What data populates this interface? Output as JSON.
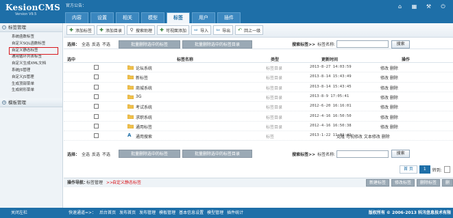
{
  "header": {
    "logo": "KesionCMS",
    "version": "Version V9.5",
    "notice": "官方公告："
  },
  "tabs": [
    {
      "label": "内容",
      "active": false
    },
    {
      "label": "设置",
      "active": false
    },
    {
      "label": "相关",
      "active": false
    },
    {
      "label": "模型",
      "active": false
    },
    {
      "label": "标签",
      "active": true
    },
    {
      "label": "用户",
      "active": false
    },
    {
      "label": "插件",
      "active": false
    }
  ],
  "top_icons": [
    "home-icon",
    "grid-icon",
    "tools-icon",
    "power-icon"
  ],
  "sidebar": {
    "section1": "标签管理",
    "items": [
      {
        "label": "系统函数标签",
        "selected": false
      },
      {
        "label": "自定义SQL函数标签",
        "selected": false
      },
      {
        "label": "自定义静态标签",
        "selected": true
      },
      {
        "label": "通用循环列表标签",
        "selected": false
      },
      {
        "label": "自定义生成XML文档",
        "selected": false
      },
      {
        "label": "系统JS管理",
        "selected": false
      },
      {
        "label": "自定义JS管理",
        "selected": false
      },
      {
        "label": "生成顶部菜单",
        "selected": false
      },
      {
        "label": "生成树形菜单",
        "selected": false
      }
    ],
    "section2": "模板管理"
  },
  "toolbar": {
    "buttons": [
      {
        "label": "添加标签",
        "icon": "add-icon"
      },
      {
        "label": "添加目录",
        "icon": "add-folder-icon"
      },
      {
        "label": "搜索助理",
        "icon": "search-icon"
      },
      {
        "label": "可视面添加",
        "icon": "visual-add-icon"
      },
      {
        "label": "导入",
        "icon": "import-icon"
      },
      {
        "label": "导出",
        "icon": "export-icon"
      },
      {
        "label": "回上一级",
        "icon": "back-icon"
      }
    ]
  },
  "selection": {
    "label": "选择：",
    "all": "全选",
    "invert": "反选",
    "none": "不选",
    "delete_tags": "批量删除选中的标签",
    "delete_dirs": "批量删除选中的标签目录",
    "search_label_top": "搜索标签>>",
    "search_label_bottom": "搜索标签>>",
    "search_field": "标签名称:",
    "search_button": "搜索"
  },
  "table": {
    "headers": {
      "select": "选中",
      "name": "标签名称",
      "type": "类型",
      "time": "更新时间",
      "ops": "操作"
    },
    "rows": [
      {
        "name": "论坛系统",
        "type": "标签目录",
        "time": "2013-8-27 14:03:59",
        "ops": "修改 删除",
        "icon": "folder-icon"
      },
      {
        "name": "新标签",
        "type": "标签目录",
        "time": "2013-8-14 15:43:49",
        "ops": "修改 删除",
        "icon": "folder-icon"
      },
      {
        "name": "商城系统",
        "type": "标签目录",
        "time": "2013-8-14 15:43:45",
        "ops": "修改 删除",
        "icon": "folder-icon"
      },
      {
        "name": "3G",
        "type": "标签目录",
        "time": "2013-8-9 17:05:41",
        "ops": "修改 删除",
        "icon": "folder-icon"
      },
      {
        "name": "考试系统",
        "type": "标签目录",
        "time": "2012-6-20 16:16:01",
        "ops": "修改 删除",
        "icon": "folder-icon"
      },
      {
        "name": "求职系统",
        "type": "标签目录",
        "time": "2012-4-16 16:50:50",
        "ops": "修改 删除",
        "icon": "folder-icon"
      },
      {
        "name": "通用标签",
        "type": "标签目录",
        "time": "2012-4-16 16:50:38",
        "ops": "修改 删除",
        "icon": "folder-icon"
      },
      {
        "name": "通用搜索",
        "type": "标签",
        "time": "2013-1-22 11:02:41",
        "ops": "克隆 可视修改 文本修改 删除",
        "icon": "text-tag-icon"
      }
    ]
  },
  "pager": {
    "first": "首 页",
    "current": "1",
    "goto": "转到:"
  },
  "opnav": {
    "label": "操作导航：",
    "crumb1": "标签管理",
    "sep": ">>",
    "crumb2": "自定义静态标签",
    "buttons": [
      "新建标签",
      "修改标签",
      "删除标签",
      "删"
    ]
  },
  "footer": {
    "close_left": "关闭左栏",
    "nav_label": "快速通道=>：",
    "nav": [
      "后台首页",
      "发布首页",
      "发布管理",
      "模板管理",
      "基本信息设置",
      "模型管理",
      "插件统计"
    ],
    "copyright": "版权所有 © 2006-2013 科汛信息技术有限"
  },
  "colors": {
    "primary": "#1e6fa8",
    "highlight": "#d8141a",
    "folder": "#f0c14b"
  }
}
